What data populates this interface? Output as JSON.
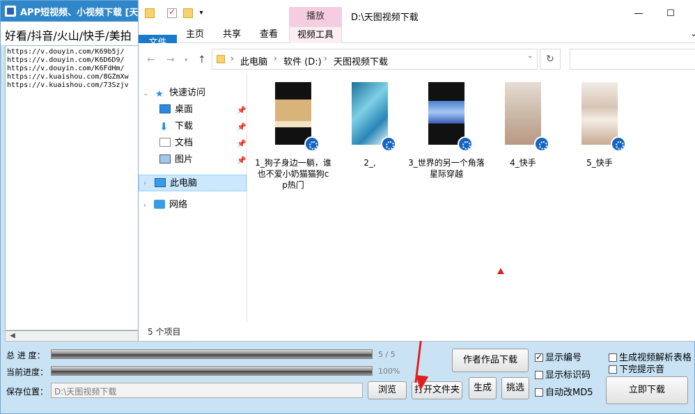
{
  "app": {
    "title": "APP短视频、小视频下载 [天图视",
    "platforms": "好看/抖音/火山/快手/美拍",
    "links": [
      "https://v.douyin.com/K69b5j/",
      "https://v.douyin.com/K6D6D9/",
      "https://v.douyin.com/K6FdHm/",
      "https://v.kuaishou.com/8GZmXw",
      "https://v.kuaishou.com/73Szjv"
    ],
    "total_progress_label": "总 进 度：",
    "total_progress_value": "5 / 5",
    "total_progress_fraction": 1.0,
    "current_progress_label": "当前进度：",
    "current_progress_value": "100%",
    "current_progress_fraction": 1.0,
    "save_label": "保存位置：",
    "save_path": "D:\\天图视频下载",
    "browse_button": "浏览",
    "open_folder_button": "打开文件夹",
    "generate_button": "生成",
    "pick_button": "挑选",
    "author_download_button": "作者作品下载",
    "download_now_button": "立即下载",
    "options": {
      "show_number": {
        "label": "显示编号",
        "checked": true
      },
      "show_id": {
        "label": "显示标识码",
        "checked": false
      },
      "auto_md5": {
        "label": "自动改MD5",
        "checked": false
      },
      "gen_table": {
        "label": "生成视频解析表格",
        "checked": false
      },
      "sound_done": {
        "label": "下完提示音",
        "checked": false
      }
    }
  },
  "explorer": {
    "context_tab": "播放",
    "path_title": "D:\\天图视频下载",
    "ribbon_tabs": [
      "文件",
      "主页",
      "共享",
      "查看",
      "视频工具"
    ],
    "breadcrumb": [
      "此电脑",
      "软件 (D:)",
      "天图视频下载"
    ],
    "nav": {
      "quick_access": "快速访问",
      "desktop": "桌面",
      "downloads": "下载",
      "documents": "文档",
      "pictures": "图片",
      "this_pc": "此电脑",
      "network": "网络"
    },
    "files": [
      {
        "name": "1_狗子身边一躺，谁也不爱小奶猫猫狗cp热门"
      },
      {
        "name": "2_,"
      },
      {
        "name": "3_世界的另一个角落星际穿越"
      },
      {
        "name": "4_快手"
      },
      {
        "name": "5_快手"
      }
    ],
    "status": "5 个项目"
  }
}
